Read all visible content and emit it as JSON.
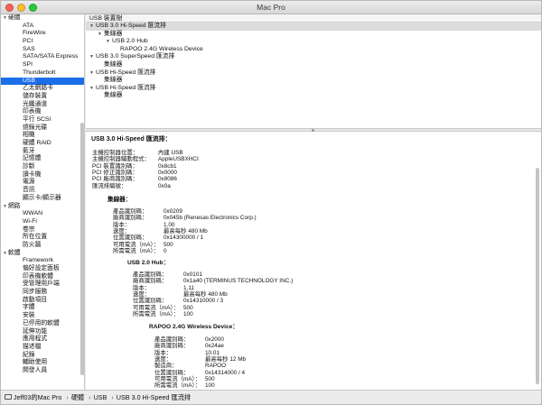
{
  "window": {
    "title": "Mac Pro"
  },
  "sidebar": {
    "categories": [
      {
        "label": "硬體",
        "items": [
          "ATA",
          "FireWire",
          "PCI",
          "SAS",
          "SATA/SATA Express",
          "SPI",
          "Thunderbolt",
          "USB",
          "乙太網路卡",
          "儲存裝置",
          "光纖通道",
          "印表機",
          "平行 SCSI",
          "燒錄光碟",
          "相機",
          "硬體 RAID",
          "藍牙",
          "記憶體",
          "診斷",
          "讀卡機",
          "電源",
          "音訊",
          "顯示卡/顯示器"
        ]
      },
      {
        "label": "網路",
        "items": [
          "WWAN",
          "Wi-Fi",
          "卷宗",
          "所在位置",
          "防火牆"
        ]
      },
      {
        "label": "軟體",
        "items": [
          "Framework",
          "偏好設定面板",
          "印表機軟體",
          "受管理用戶端",
          "同步服務",
          "啟動項目",
          "字體",
          "安裝",
          "已停用的軟體",
          "延伸功能",
          "應用程式",
          "描述檔",
          "紀錄",
          "輔助使用",
          "開發人員"
        ]
      }
    ],
    "selected": "USB"
  },
  "tree": {
    "header": "USB 裝置樹",
    "rows": [
      {
        "label": "USB 3.0 Hi-Speed 匯流排",
        "indent": 0,
        "tri": "▼",
        "selected": true
      },
      {
        "label": "集線器",
        "indent": 1,
        "tri": "▼"
      },
      {
        "label": "USB 2.0 Hub",
        "indent": 2,
        "tri": "▼"
      },
      {
        "label": "RAPOO 2.4G Wireless Device",
        "indent": 3,
        "tri": ""
      },
      {
        "label": "USB 3.0 SuperSpeed 匯流排",
        "indent": 0,
        "tri": "▼"
      },
      {
        "label": "集線器",
        "indent": 1,
        "tri": ""
      },
      {
        "label": "USB Hi-Speed 匯流排",
        "indent": 0,
        "tri": "▼"
      },
      {
        "label": "集線器",
        "indent": 1,
        "tri": ""
      },
      {
        "label": "USB Hi-Speed 匯流排",
        "indent": 0,
        "tri": "▼"
      },
      {
        "label": "集線器",
        "indent": 1,
        "tri": ""
      }
    ]
  },
  "detail": {
    "title": "USB 3.0 Hi-Speed 匯流排：",
    "bus": [
      [
        "主機控制器位置：",
        "內建 USB"
      ],
      [
        "主機控制器驅動程式：",
        "AppleUSBXHCI"
      ],
      [
        "PCI 裝置識別碼：",
        "0x8cb1"
      ],
      [
        "PCI 修正識別碼：",
        "0x0000"
      ],
      [
        "PCI 廠商識別碼：",
        "0x8086"
      ],
      [
        "匯流排編號：",
        "0x0a"
      ]
    ],
    "hub": {
      "title": "集線器：",
      "props": [
        [
          "產品識別碼：",
          "0x0209"
        ],
        [
          "廠商識別碼：",
          "0x045b  (Renesas Electronics Corp.)"
        ],
        [
          "版本：",
          "1.00"
        ],
        [
          "速度：",
          "最高每秒 480 Mb"
        ],
        [
          "位置識別碼：",
          "0x14300000 / 1"
        ],
        [
          "可用電流（mA）：",
          "500"
        ],
        [
          "所需電流（mA）：",
          "0"
        ]
      ]
    },
    "usb_hub": {
      "title": "USB 2.0 Hub：",
      "props": [
        [
          "產品識別碼：",
          "0x0101"
        ],
        [
          "廠商識別碼：",
          "0x1a40  (TERMINUS TECHNOLOGY INC.)"
        ],
        [
          "版本：",
          "1.11"
        ],
        [
          "速度：",
          "最高每秒 480 Mb"
        ],
        [
          "位置識別碼：",
          "0x14310000 / 3"
        ],
        [
          "可用電流（mA）：",
          "500"
        ],
        [
          "所需電流（mA）：",
          "100"
        ]
      ]
    },
    "rapoo": {
      "title": "RAPOO 2.4G Wireless Device：",
      "props": [
        [
          "產品識別碼：",
          "0x2000"
        ],
        [
          "廠商識別碼：",
          "0x24ae"
        ],
        [
          "版本：",
          "10.01"
        ],
        [
          "速度：",
          "最高每秒 12 Mb"
        ],
        [
          "製造商：",
          "RAPOO"
        ],
        [
          "位置識別碼：",
          "0x14314000 / 4"
        ],
        [
          "可用電流（mA）：",
          "500"
        ],
        [
          "所需電流（mA）：",
          "100"
        ]
      ]
    }
  },
  "statusbar": {
    "crumbs": [
      "Jeff03的Mac Pro",
      "硬體",
      "USB",
      "USB 3.0 Hi-Speed 匯流排"
    ]
  }
}
